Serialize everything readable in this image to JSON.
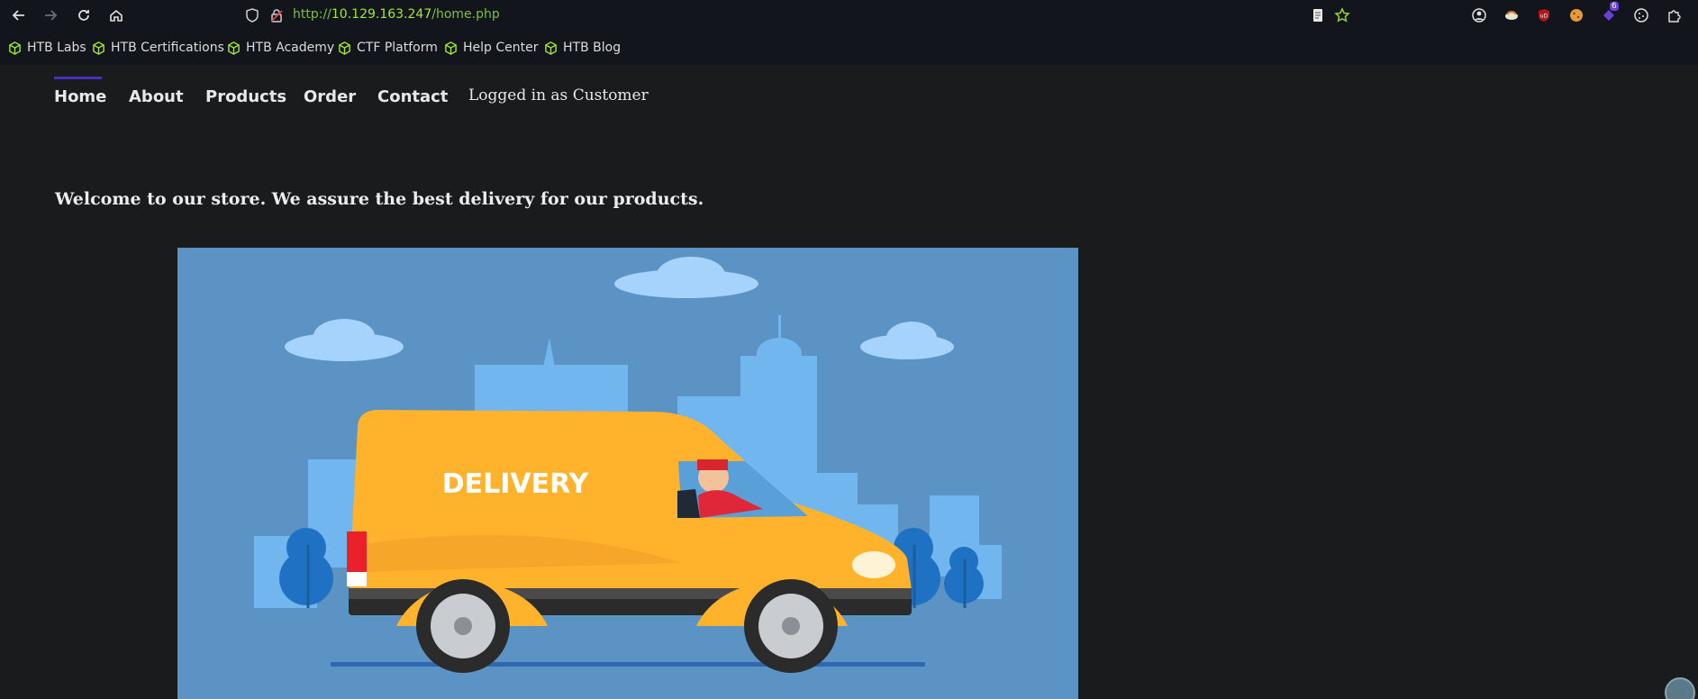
{
  "browser": {
    "url": {
      "proto": "http://",
      "host": "10.129.163.247",
      "path": "/home.php"
    },
    "bookmarks": [
      {
        "label": "HTB Labs"
      },
      {
        "label": "HTB Certifications"
      },
      {
        "label": "HTB Academy"
      },
      {
        "label": "CTF Platform"
      },
      {
        "label": "Help Center"
      },
      {
        "label": "HTB Blog"
      }
    ],
    "extension_badge": "6"
  },
  "nav": {
    "items": [
      {
        "label": "Home"
      },
      {
        "label": "About"
      },
      {
        "label": "Products"
      },
      {
        "label": "Order"
      },
      {
        "label": "Contact"
      }
    ],
    "status": "Logged in as Customer"
  },
  "main": {
    "welcome": "Welcome to our store. We assure the best delivery for our products.",
    "hero_van_text": "DELIVERY"
  },
  "colors": {
    "nav_active": "#4a2fbf",
    "bookmark_icon": "#a3e635",
    "hero_bg": "#5b93c4",
    "van": "#ffb22c"
  }
}
